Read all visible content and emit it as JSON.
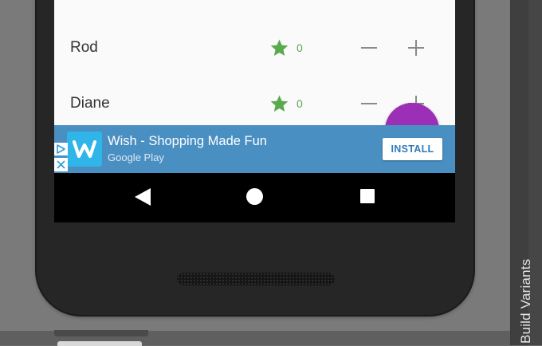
{
  "ide": {
    "side_panel_label": "Build Variants"
  },
  "list": {
    "rows": [
      {
        "name": "",
        "score": ""
      },
      {
        "name": "Rod",
        "score": "0"
      },
      {
        "name": "Diane",
        "score": "0"
      }
    ],
    "row_icons": {
      "star": "star-icon",
      "decrement": "minus-icon",
      "increment": "plus-icon"
    }
  },
  "fab": {
    "icon": "add-icon",
    "color": "#9b2fb5"
  },
  "ad": {
    "title": "Wish - Shopping Made Fun",
    "subtitle": "Google Play",
    "install_label": "INSTALL",
    "background": "#4a8fc2",
    "app_icon": "wish-logo-icon",
    "choices_icon": "adchoices-icon",
    "close_icon": "close-icon"
  },
  "navbar": {
    "buttons": [
      "back-icon",
      "home-icon",
      "recents-icon"
    ]
  },
  "colors": {
    "star": "#5aa94f",
    "score_text": "#5aa94f",
    "nav_background": "#000000"
  }
}
